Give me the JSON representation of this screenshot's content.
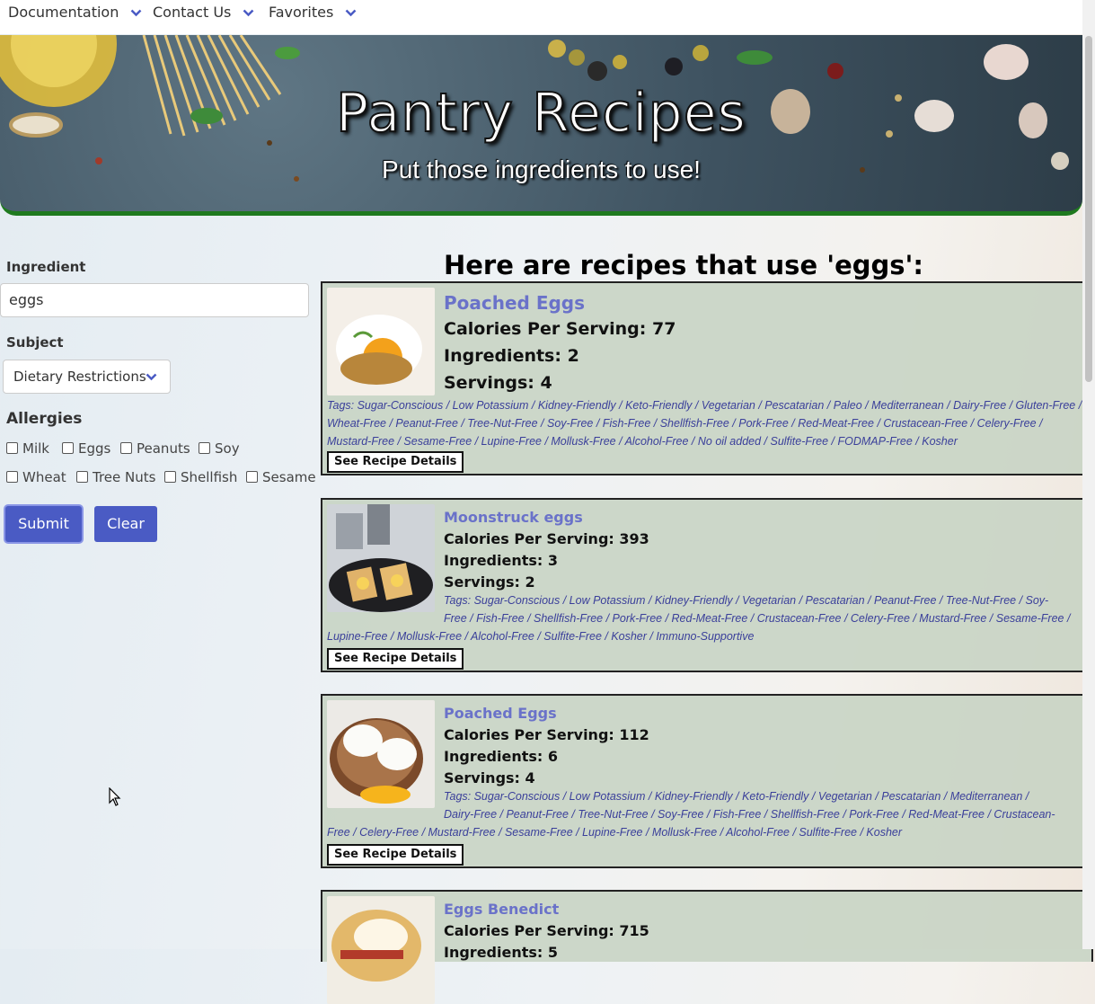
{
  "nav": {
    "items": [
      {
        "label": "Documentation"
      },
      {
        "label": "Contact Us"
      },
      {
        "label": "Favorites"
      }
    ]
  },
  "banner": {
    "title": "Pantry Recipes",
    "subtitle": "Put those ingredients to use!"
  },
  "form": {
    "ingredient_label": "Ingredient",
    "ingredient_value": "eggs",
    "subject_label": "Subject",
    "subject_value": "Dietary Restrictions",
    "allergies_label": "Allergies",
    "allergies": [
      {
        "label": "Milk",
        "checked": false
      },
      {
        "label": "Eggs",
        "checked": false
      },
      {
        "label": "Peanuts",
        "checked": false
      },
      {
        "label": "Soy",
        "checked": false
      },
      {
        "label": "Wheat",
        "checked": false
      },
      {
        "label": "Tree Nuts",
        "checked": false
      },
      {
        "label": "Shellfish",
        "checked": false
      },
      {
        "label": "Sesame",
        "checked": false
      }
    ],
    "submit_label": "Submit",
    "clear_label": "Clear"
  },
  "results": {
    "heading": "Here are recipes that use 'eggs':",
    "details_label": "See Recipe Details",
    "recipes": [
      {
        "title": "Poached Eggs",
        "calories": "Calories Per Serving: 77",
        "ingredients": "Ingredients: 2",
        "servings": "Servings: 4",
        "tags": "Tags: Sugar-Conscious / Low Potassium / Kidney-Friendly / Keto-Friendly / Vegetarian / Pescatarian / Paleo / Mediterranean / Dairy-Free / Gluten-Free / Wheat-Free / Peanut-Free / Tree-Nut-Free / Soy-Free / Fish-Free / Shellfish-Free / Pork-Free / Red-Meat-Free / Crustacean-Free / Celery-Free / Mustard-Free / Sesame-Free / Lupine-Free / Mollusk-Free / Alcohol-Free / No oil added / Sulfite-Free / FODMAP-Free / Kosher"
      },
      {
        "title": "Moonstruck eggs",
        "calories": "Calories Per Serving: 393",
        "ingredients": "Ingredients: 3",
        "servings": "Servings: 2",
        "tags_first": "Tags: Sugar-Conscious / Low Potassium / Kidney-Friendly / Vegetarian / Pescatarian / Peanut-Free / Tree-Nut-Free / Soy-",
        "tags_rest": "Free / Fish-Free / Shellfish-Free / Pork-Free / Red-Meat-Free / Crustacean-Free / Celery-Free / Mustard-Free / Sesame-Free /",
        "tags_last": "Lupine-Free / Mollusk-Free / Alcohol-Free / Sulfite-Free / Kosher / Immuno-Supportive"
      },
      {
        "title": "Poached Eggs",
        "calories": "Calories Per Serving: 112",
        "ingredients": "Ingredients: 6",
        "servings": "Servings: 4",
        "tags_first": "Tags: Sugar-Conscious / Low Potassium / Kidney-Friendly / Keto-Friendly / Vegetarian / Pescatarian / Mediterranean /",
        "tags_rest": "Dairy-Free / Peanut-Free / Tree-Nut-Free / Soy-Free / Fish-Free / Shellfish-Free / Pork-Free / Red-Meat-Free / Crustacean-",
        "tags_last": "Free / Celery-Free / Mustard-Free / Sesame-Free / Lupine-Free / Mollusk-Free / Alcohol-Free / Sulfite-Free / Kosher"
      },
      {
        "title": "Eggs Benedict",
        "calories": "Calories Per Serving: 715",
        "ingredients": "Ingredients: 5"
      }
    ]
  }
}
